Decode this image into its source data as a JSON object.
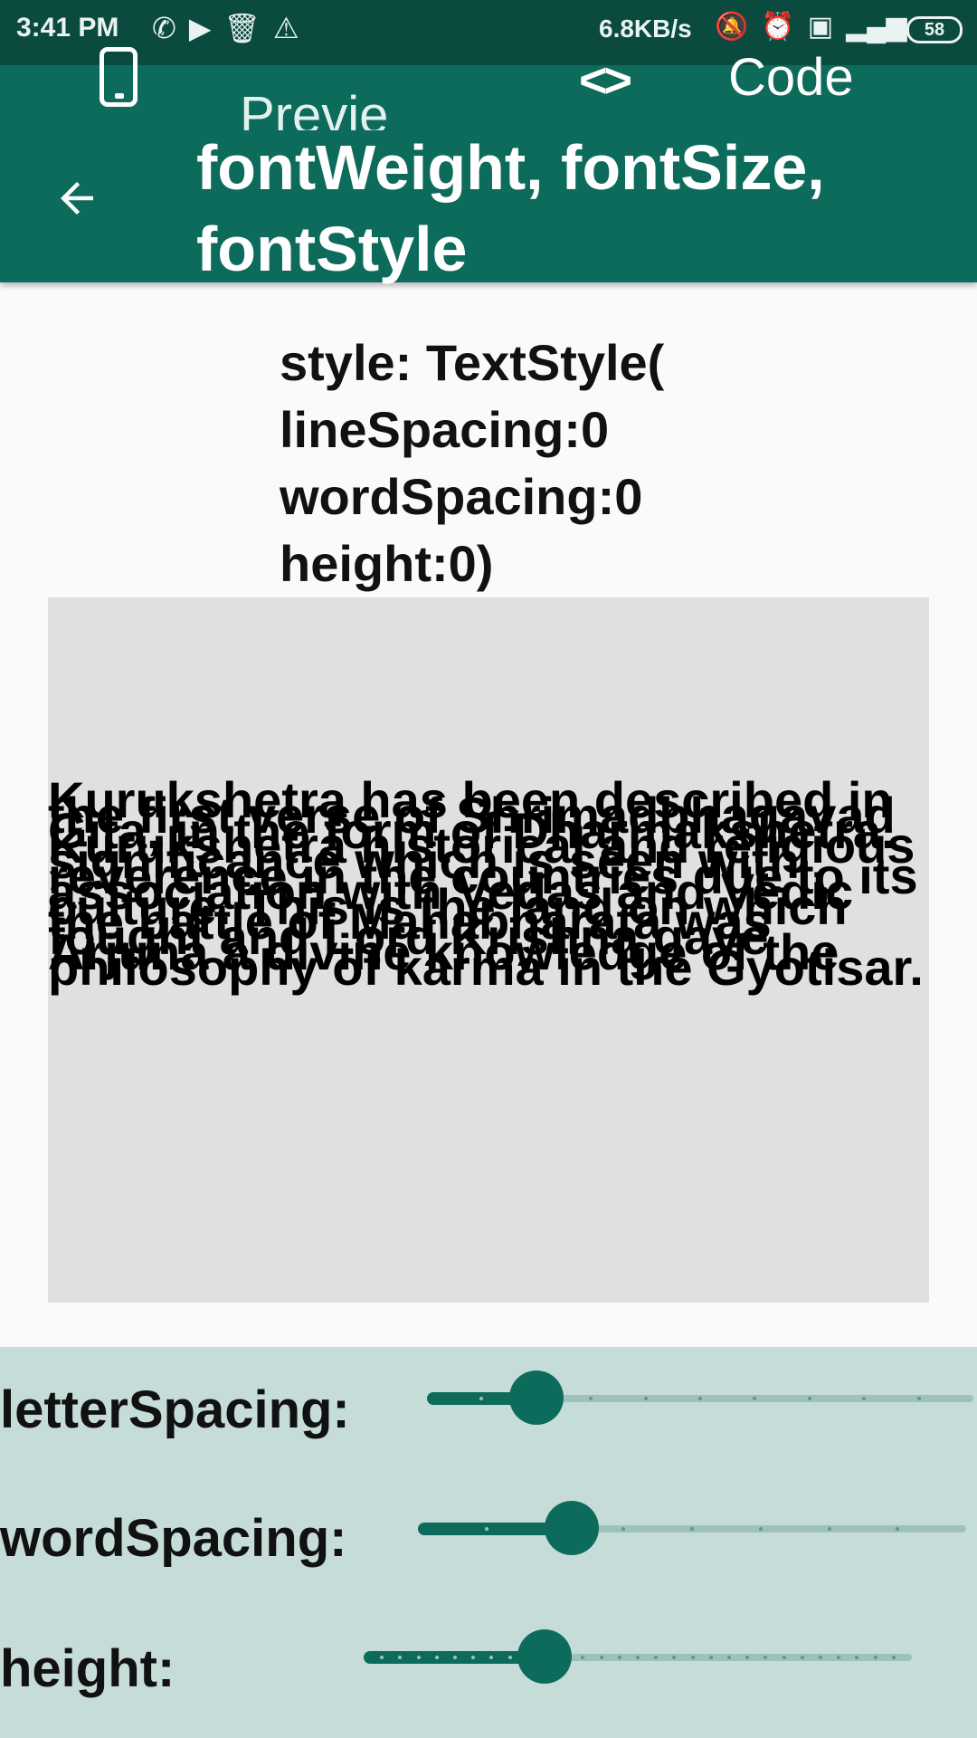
{
  "status_bar": {
    "time": "3:41 PM",
    "network_speed": "6.8KB/s",
    "battery": "58",
    "left_icons": [
      "whatsapp-icon",
      "youtube-icon",
      "trash-icon",
      "warning-icon"
    ],
    "right_icons": [
      "mute-icon",
      "alarm-icon",
      "volte-icon",
      "signal-icon"
    ]
  },
  "tabs": {
    "preview_label": "Preview",
    "code_label": "Code",
    "code_icon": "<>"
  },
  "app_bar": {
    "title": "fontWeight, fontSize, fontStyle"
  },
  "style_description": "style: TextStyle(\nlineSpacing:0\nwordSpacing:0\nheight:0)",
  "preview_text": "Kurukshetra has been described in the first verse of Shrimadbhagavad Gita, in the form of Dharmakshetra. Kurukshetra historical and religious significance which is seen with reverence in the countries due to its association with Vedas and Vedic culture. This is the land on which the battle of Mahabharata was fought and Lord Krishna gave Arjuna a divine knowledge of the philosophy of karma in the Gyotisar.",
  "controls": [
    {
      "label": "letterSpacing:",
      "fraction": 0.2,
      "ticks": 10
    },
    {
      "label": "wordSpacing:",
      "fraction": 0.28,
      "ticks": 8
    },
    {
      "label": "height:",
      "fraction": 0.33,
      "ticks": 30
    }
  ],
  "colors": {
    "primary": "#0d6b5c",
    "status_bar": "#0a4a3f",
    "controls_bg": "#c6dcd9",
    "preview_bg": "#e0e0e0"
  }
}
